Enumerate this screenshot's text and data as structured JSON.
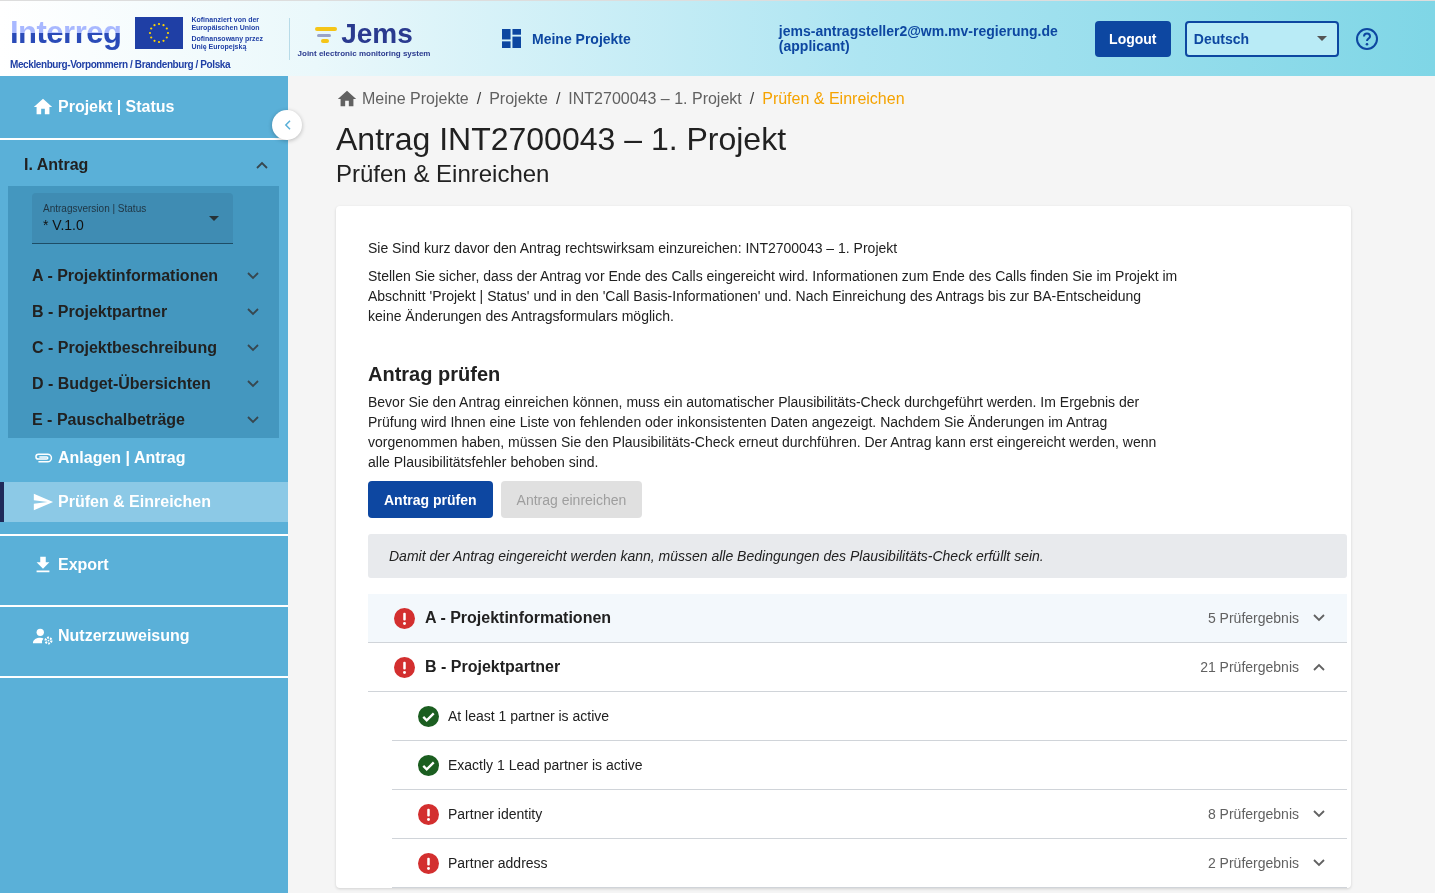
{
  "header": {
    "logo": {
      "name": "Interreg",
      "cofinance_de": "Kofinanziert von der Europäischen Union",
      "cofinance_pl": "Dofinansowany przez Unię Europejską",
      "region": "Mecklenburg-Vorpommern / Brandenburg / Polska"
    },
    "app_logo": {
      "name": "Jems",
      "tagline": "Joint electronic monitoring system"
    },
    "nav": "Meine Projekte",
    "user": {
      "email": "jems-antragsteller2@wm.mv-regierung.de",
      "role": "(applicant)"
    },
    "logout": "Logout",
    "language": "Deutsch"
  },
  "sidebar": {
    "items": [
      {
        "kind": "link",
        "label": "Projekt | Status",
        "selected": false,
        "divider": true
      },
      {
        "kind": "group",
        "label": "I. Antrag",
        "expanded": true,
        "version": {
          "label": "Antragsversion | Status",
          "value": "* V.1.0"
        },
        "children": [
          {
            "label": "A - Projektinformationen",
            "expanded": false
          },
          {
            "label": "B - Projektpartner",
            "expanded": false
          },
          {
            "label": "C - Projektbeschreibung",
            "expanded": false
          },
          {
            "label": "D - Budget-Übersichten",
            "expanded": false
          },
          {
            "label": "E - Pauschalbeträge",
            "expanded": false
          }
        ]
      },
      {
        "kind": "link",
        "label": "Anlagen | Antrag",
        "selected": false,
        "divider": false
      },
      {
        "kind": "link",
        "label": "Prüfen & Einreichen",
        "selected": true,
        "divider": true
      },
      {
        "kind": "link",
        "label": "Export",
        "selected": false,
        "divider": true
      },
      {
        "kind": "link",
        "label": "Nutzerzuweisung",
        "selected": false,
        "divider": true
      }
    ]
  },
  "breadcrumbs": [
    {
      "label": "Meine Projekte",
      "current": false
    },
    {
      "separator": "/",
      "label": "Projekte",
      "current": false
    },
    {
      "separator": "/",
      "label": "INT2700043 – 1. Projekt",
      "current": false
    },
    {
      "separator": "/",
      "label": "Prüfen & Einreichen",
      "current": true
    }
  ],
  "page": {
    "title": "Antrag INT2700043 – 1. Projekt",
    "subtitle": "Prüfen & Einreichen"
  },
  "card": {
    "intro": [
      "Sie Sind kurz davor den Antrag rechtswirksam einzureichen: INT2700043 – 1. Projekt",
      "Stellen Sie sicher, dass der Antrag vor Ende des Calls eingereicht wird. Informationen zum Ende des Calls finden Sie im Projekt im Abschnitt 'Projekt | Status' und in den 'Call Basis-Informationen' und. Nach Einreichung des Antrags bis zur BA-Entscheidung keine Änderungen des Antragsformulars möglich."
    ],
    "section_title": "Antrag prüfen",
    "section_text": "Bevor Sie den Antrag einreichen können, muss ein automatischer Plausibilitäts-Check durchgeführt werden. Im Ergebnis der Prüfung wird Ihnen eine Liste von fehlenden oder inkonsistenten Daten angezeigt. Nachdem Sie Änderungen im Antrag vorgenommen haben, müssen Sie den Plausibilitäts-Check erneut durchführen. Der Antrag kann erst eingereicht werden, wenn alle Plausibilitätsfehler behoben sind.",
    "buttons": [
      {
        "label": "Antrag prüfen",
        "disabled": false
      },
      {
        "label": "Antrag einreichen",
        "disabled": true
      }
    ],
    "notice": "Damit der Antrag eingereicht werden kann, müssen alle Bedingungen des Plausibilitäts-Check erfüllt sein.",
    "checks": [
      {
        "kind": "error",
        "title": "A - Projektinformationen",
        "count": "5 Prüfergebnis",
        "expanded": false,
        "selected": true
      },
      {
        "kind": "error",
        "title": "B - Projektpartner",
        "count": "21 Prüfergebnis",
        "expanded": true,
        "selected": false,
        "children": [
          {
            "kind": "ok",
            "title": "At least 1 partner is active"
          },
          {
            "kind": "ok",
            "title": "Exactly 1 Lead partner is active"
          },
          {
            "kind": "error",
            "title": "Partner identity",
            "count": "8 Prüfergebnis",
            "expanded": false
          },
          {
            "kind": "error",
            "title": "Partner address",
            "count": "2 Prüfergebnis",
            "expanded": false
          }
        ]
      }
    ]
  }
}
